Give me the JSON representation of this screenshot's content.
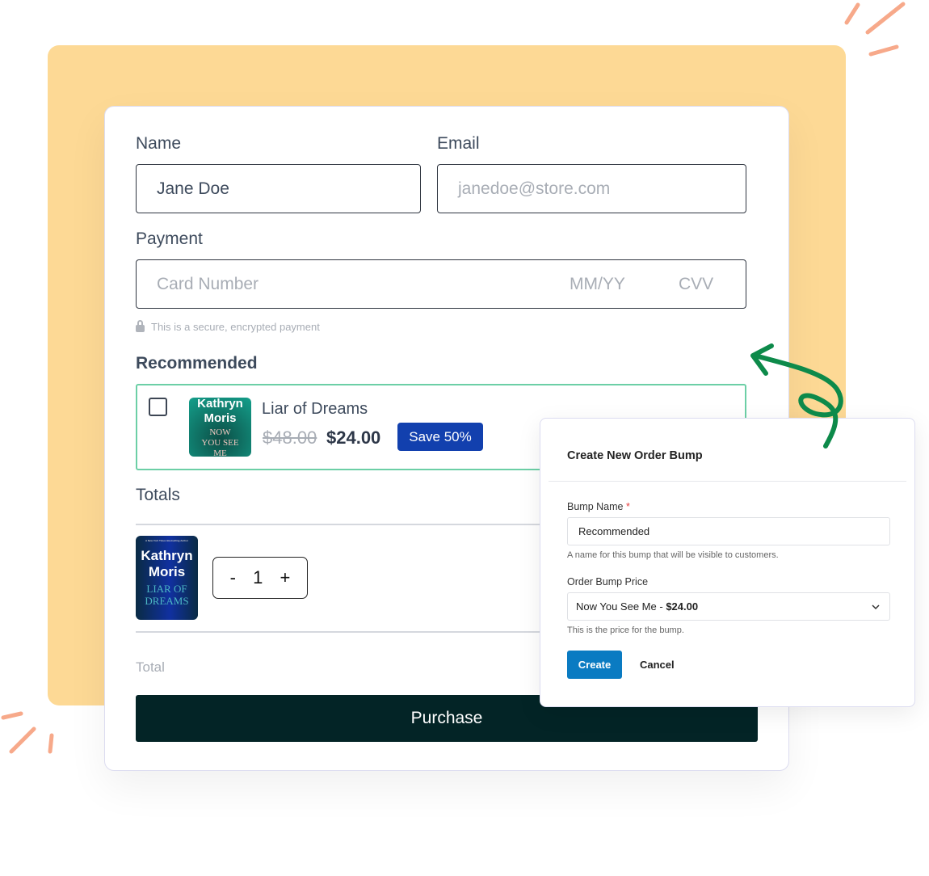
{
  "form": {
    "name_label": "Name",
    "name_value": "Jane Doe",
    "email_label": "Email",
    "email_placeholder": "janedoe@store.com",
    "payment_label": "Payment",
    "card_placeholder": "Card Number",
    "expiry_placeholder": "MM/YY",
    "cvv_placeholder": "CVV",
    "secure_note": "This is a secure, encrypted payment"
  },
  "recommended": {
    "heading": "Recommended",
    "product_title": "Liar of Dreams",
    "old_price": "$48.00",
    "new_price": "$24.00",
    "badge": "Save 50%",
    "cover": {
      "author_line1": "Kathryn",
      "author_line2": "Moris",
      "title_line1": "NOW",
      "title_line2": "YOU SEE",
      "title_line3": "ME"
    }
  },
  "totals": {
    "heading": "Totals",
    "cover": {
      "tagline": "A New York Times Bestselling Author",
      "author_line1": "Kathryn",
      "author_line2": "Moris",
      "title_line1": "LIAR OF",
      "title_line2": "DREAMS"
    },
    "qty_minus": "-",
    "qty_value": "1",
    "qty_plus": "+",
    "total_label": "Total"
  },
  "purchase_label": "Purchase",
  "modal": {
    "title": "Create New Order Bump",
    "bump_name_label": "Bump Name",
    "required_mark": "*",
    "bump_name_value": "Recommended",
    "bump_name_help": "A name for this bump that will be visible to customers.",
    "price_label": "Order Bump Price",
    "price_product": "Now You See Me -",
    "price_value": "$24.00",
    "price_help": "This is the price for the bump.",
    "create_label": "Create",
    "cancel_label": "Cancel"
  },
  "colors": {
    "accent_yellow": "#fdd995",
    "badge_blue": "#1240ae",
    "purchase": "#032426",
    "create_blue": "#0a7bc2",
    "arrow_green": "#0d8a4a",
    "rec_border": "#6ccfa6"
  }
}
